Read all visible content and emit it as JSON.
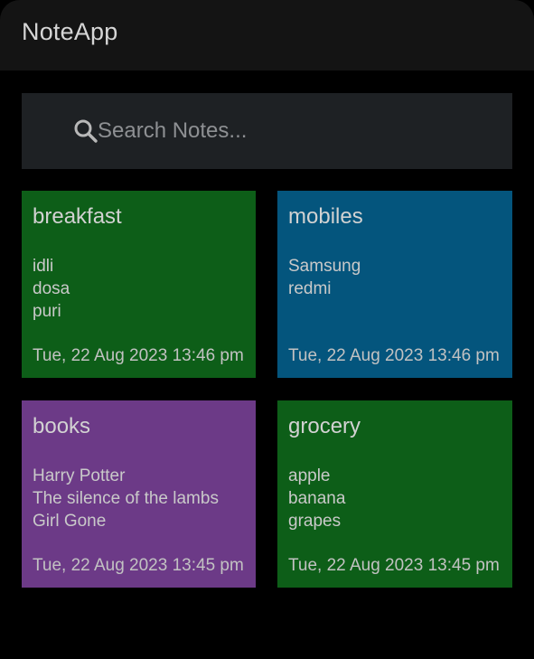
{
  "app": {
    "title": "NoteApp"
  },
  "search": {
    "placeholder": "Search Notes...",
    "value": ""
  },
  "colors": {
    "background": "#000000",
    "appbar": "#141414",
    "search_bg": "#1e2124",
    "green": "#0d5e18",
    "blue": "#04557d",
    "purple": "#6c3a87"
  },
  "notes": [
    {
      "title": "breakfast",
      "lines": [
        "idli",
        "dosa",
        "puri"
      ],
      "date": "Tue, 22 Aug 2023 13:46 pm",
      "color": "#0d5e18"
    },
    {
      "title": "mobiles",
      "lines": [
        "Samsung",
        "redmi"
      ],
      "date": "Tue, 22 Aug 2023 13:46 pm",
      "color": "#04557d"
    },
    {
      "title": "books",
      "lines": [
        "Harry Potter",
        "The silence of the lambs",
        "Girl Gone"
      ],
      "date": "Tue, 22 Aug 2023 13:45 pm",
      "color": "#6c3a87"
    },
    {
      "title": "grocery",
      "lines": [
        "apple",
        "banana",
        "grapes"
      ],
      "date": "Tue, 22 Aug 2023 13:45 pm",
      "color": "#0d5e18"
    }
  ]
}
